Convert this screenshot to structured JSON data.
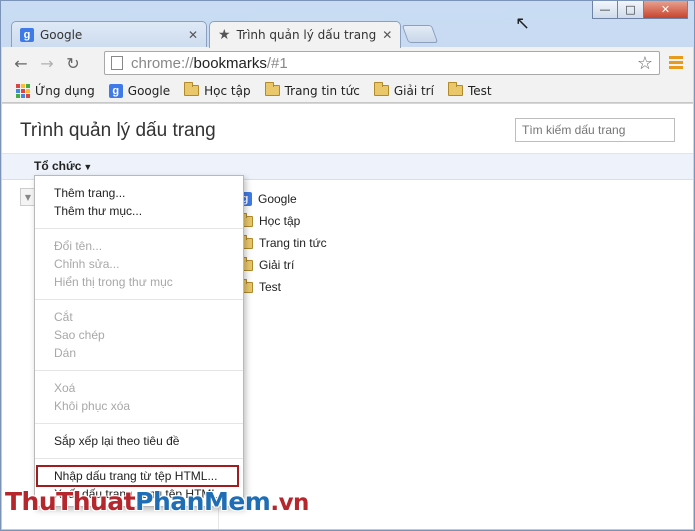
{
  "tabs": [
    {
      "title": "Google",
      "active": false
    },
    {
      "title": "Trình quản lý dấu trang",
      "active": true
    }
  ],
  "toolbar": {
    "url_prefix": "chrome://",
    "url_host": "bookmarks",
    "url_suffix": "/#1"
  },
  "bookmarks_bar": [
    {
      "label": "Ứng dụng",
      "icon": "apps-icon"
    },
    {
      "label": "Google",
      "icon": "google-icon"
    },
    {
      "label": "Học tập",
      "icon": "folder-icon"
    },
    {
      "label": "Trang tin tức",
      "icon": "folder-icon"
    },
    {
      "label": "Giải trí",
      "icon": "folder-icon"
    },
    {
      "label": "Test",
      "icon": "folder-icon"
    }
  ],
  "page": {
    "title": "Trình quản lý dấu trang",
    "search_placeholder": "Tìm kiếm dấu trang",
    "organize_label": "Tổ chức"
  },
  "bookmark_list": [
    {
      "label": "Google",
      "icon": "google-icon"
    },
    {
      "label": "Học tập",
      "icon": "folder-icon"
    },
    {
      "label": "Trang tin tức",
      "icon": "folder-icon"
    },
    {
      "label": "Giải trí",
      "icon": "folder-icon"
    },
    {
      "label": "Test",
      "icon": "folder-icon"
    }
  ],
  "menu": {
    "group1": [
      "Thêm trang...",
      "Thêm thư mục..."
    ],
    "group2": [
      "Đổi tên...",
      "Chỉnh sửa...",
      "Hiển thị trong thư mục"
    ],
    "group3": [
      "Cắt",
      "Sao chép",
      "Dán"
    ],
    "group4": [
      "Xoá",
      "Khôi phục xóa"
    ],
    "group5": [
      "Sắp xếp lại theo tiêu đề"
    ],
    "group6": [
      "Nhập dấu trang từ tệp HTML...",
      "Xuất dấu trang sang tệp HTML..."
    ]
  },
  "watermark": {
    "part1": "Thu",
    "part2": "Thuat",
    "part3": "Phan",
    "part4": "Mem",
    "part5": ".vn"
  },
  "colors": {
    "highlight_border": "#a11d1d",
    "accent_blue": "#3f7be8",
    "folder": "#e9c76a"
  }
}
